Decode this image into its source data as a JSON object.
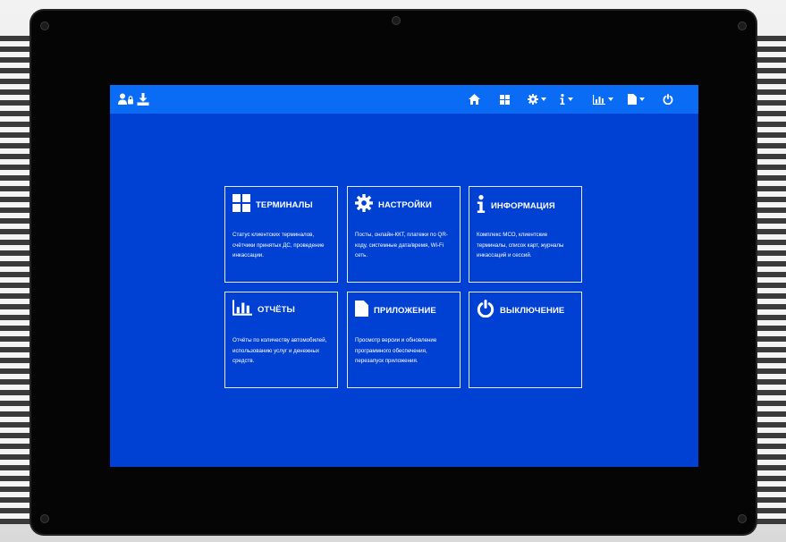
{
  "topbar": {
    "left_icons": [
      "users-lock-icon",
      "download-icon"
    ],
    "right_icons": [
      "home-icon",
      "grid-icon",
      "gear-icon",
      "info-icon",
      "chart-icon",
      "file-icon",
      "power-icon"
    ]
  },
  "tiles": [
    {
      "id": "terminals",
      "icon": "windows-grid-icon",
      "title": "ТЕРМИНАЛЫ",
      "desc": "Статус клиентских терминалов, счётчики принятых ДС, проведение инкассации."
    },
    {
      "id": "settings",
      "icon": "gear-icon",
      "title": "НАСТРОЙКИ",
      "desc": "Посты, онлайн-ККТ, платежи по QR-коду, системные дата/время, Wi-Fi сеть."
    },
    {
      "id": "info",
      "icon": "info-icon",
      "title": "ИНФОРМАЦИЯ",
      "desc": "Комплекс МСО, клиентские терминалы, список карт, журналы инкассаций и сессий."
    },
    {
      "id": "reports",
      "icon": "bar-chart-icon",
      "title": "ОТЧЁТЫ",
      "desc": "Отчёты по количеству автомобилей, использованию услуг и денежных средств."
    },
    {
      "id": "app",
      "icon": "file-icon",
      "title": "ПРИЛОЖЕНИЕ",
      "desc": "Просмотр версии и обновление программного обеспечения, перезапуск приложения."
    },
    {
      "id": "shutdown",
      "icon": "power-icon",
      "title": "ВЫКЛЮЧЕНИЕ",
      "desc": ""
    }
  ],
  "colors": {
    "screen_bg": "#0041d4",
    "topbar_bg": "#0a6bf5",
    "tile_border": "#e6ecff",
    "text": "#ffffff"
  }
}
